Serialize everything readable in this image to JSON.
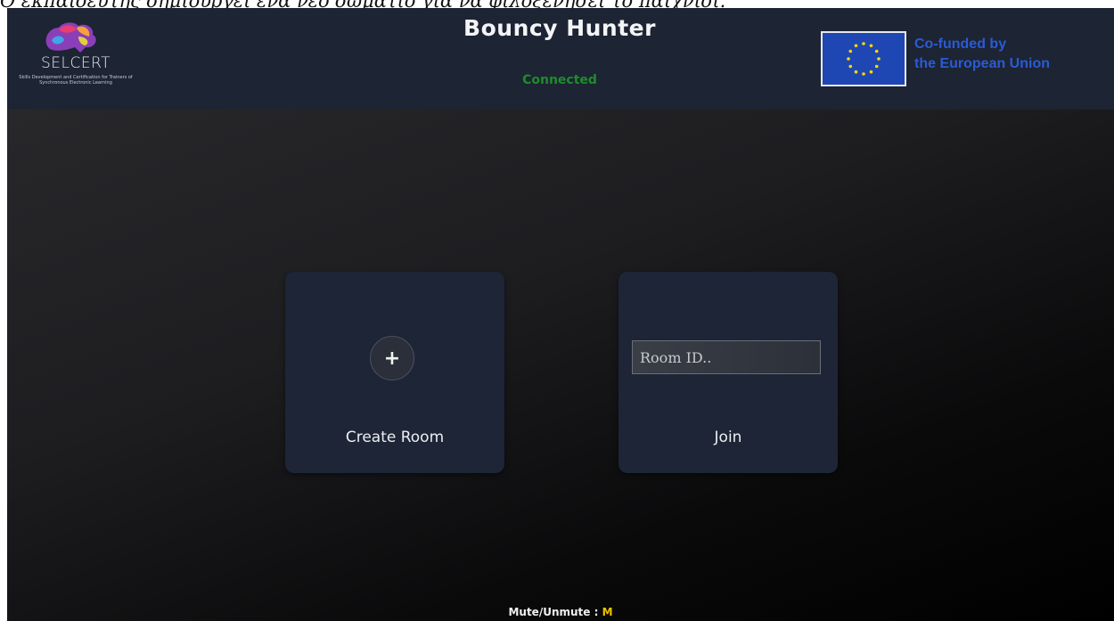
{
  "caption": "Ο εκπαιδευτής δημιουργεί ένα νέο δωμάτιο για να φιλοξενήσει το παιχνίδι.",
  "header": {
    "logo_word": "SELCERT",
    "logo_subtitle": "Skills Development and Certification for Trainers of Synchronous Electronic Learning",
    "title": "Bouncy Hunter",
    "status": "Connected",
    "eu_line1": "Co-funded by",
    "eu_line2": "the European Union"
  },
  "cards": {
    "create_label": "Create Room",
    "join_placeholder": "Room ID..",
    "join_label": "Join"
  },
  "footer": {
    "mute_label": "Mute/Unmute :",
    "mute_key": "M"
  },
  "colors": {
    "status": "#1e8c2c",
    "eu_text": "#2a5bd6",
    "mute_key": "#f2c200",
    "card_bg": "#1d2536",
    "header_bg": "#1d2433"
  }
}
